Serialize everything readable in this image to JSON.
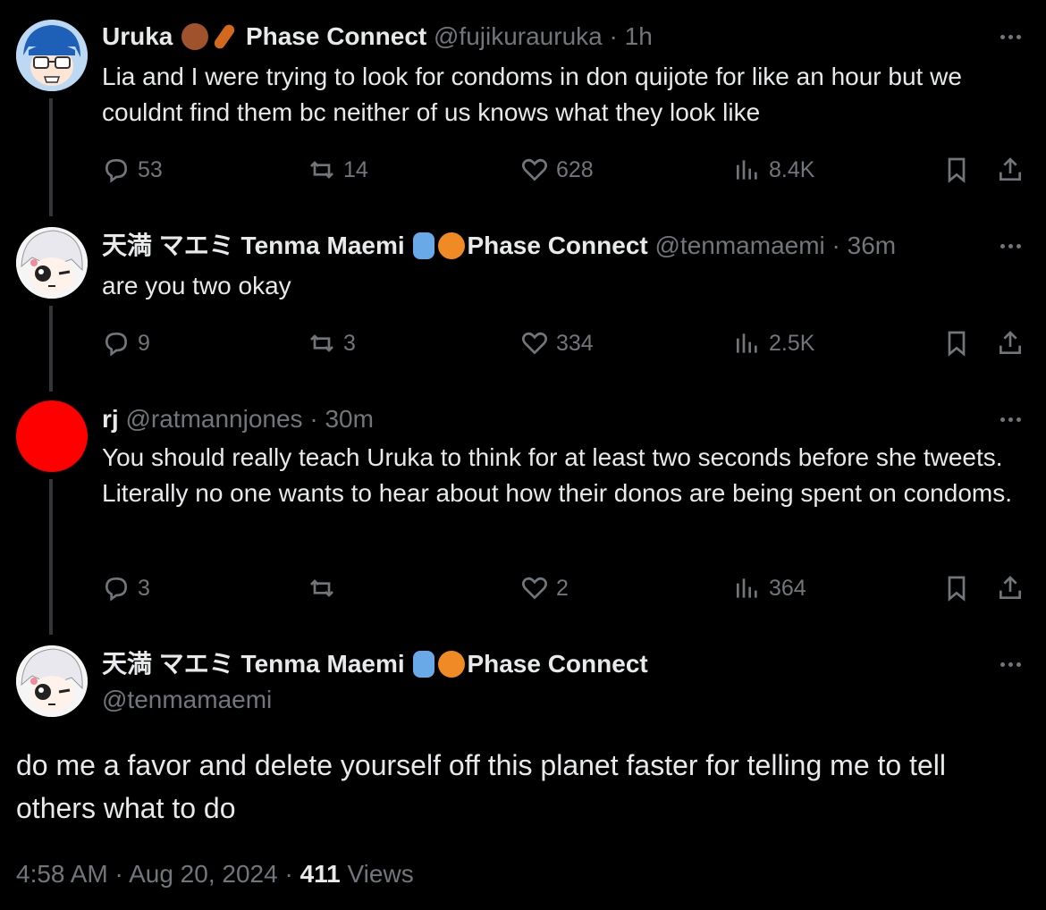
{
  "tweets": [
    {
      "name": "Uruka",
      "affiliation": "Phase Connect",
      "handle": "@fujikurauruka",
      "time": "1h",
      "text": "Lia and I were trying to look for condoms in don quijote for like an hour but we couldnt find them bc neither of us knows what they look like",
      "replies": "53",
      "retweets": "14",
      "likes": "628",
      "views": "8.4K"
    },
    {
      "name": "天満 マエミ Tenma Maemi",
      "affiliation": "Phase Connect",
      "handle": "@tenmamaemi",
      "time": "36m",
      "text": "are you two okay",
      "replies": "9",
      "retweets": "3",
      "likes": "334",
      "views": "2.5K"
    },
    {
      "name": "rj",
      "handle": "@ratmannjones",
      "time": "30m",
      "text": "You should really teach Uruka to think for at least two seconds before she tweets. Literally no one wants to hear about how their donos are being spent on condoms.",
      "replies": "3",
      "retweets": "",
      "likes": "2",
      "views": "364"
    }
  ],
  "main_tweet": {
    "name": "天満 マエミ Tenma Maemi",
    "affiliation": "Phase Connect",
    "handle": "@tenmamaemi",
    "text": "do me a favor and delete yourself off this planet faster for telling me to tell others what to do",
    "time": "4:58 AM",
    "date": "Aug 20, 2024",
    "views_count": "411",
    "views_label": "Views"
  },
  "colors": {
    "background": "#000000",
    "text": "#e7e9ea",
    "muted": "#71767b",
    "thread_line": "#333639",
    "rj_avatar": "#ff0000"
  },
  "icons": [
    "reply-icon",
    "retweet-icon",
    "like-icon",
    "views-icon",
    "bookmark-icon",
    "share-icon",
    "more-icon"
  ]
}
